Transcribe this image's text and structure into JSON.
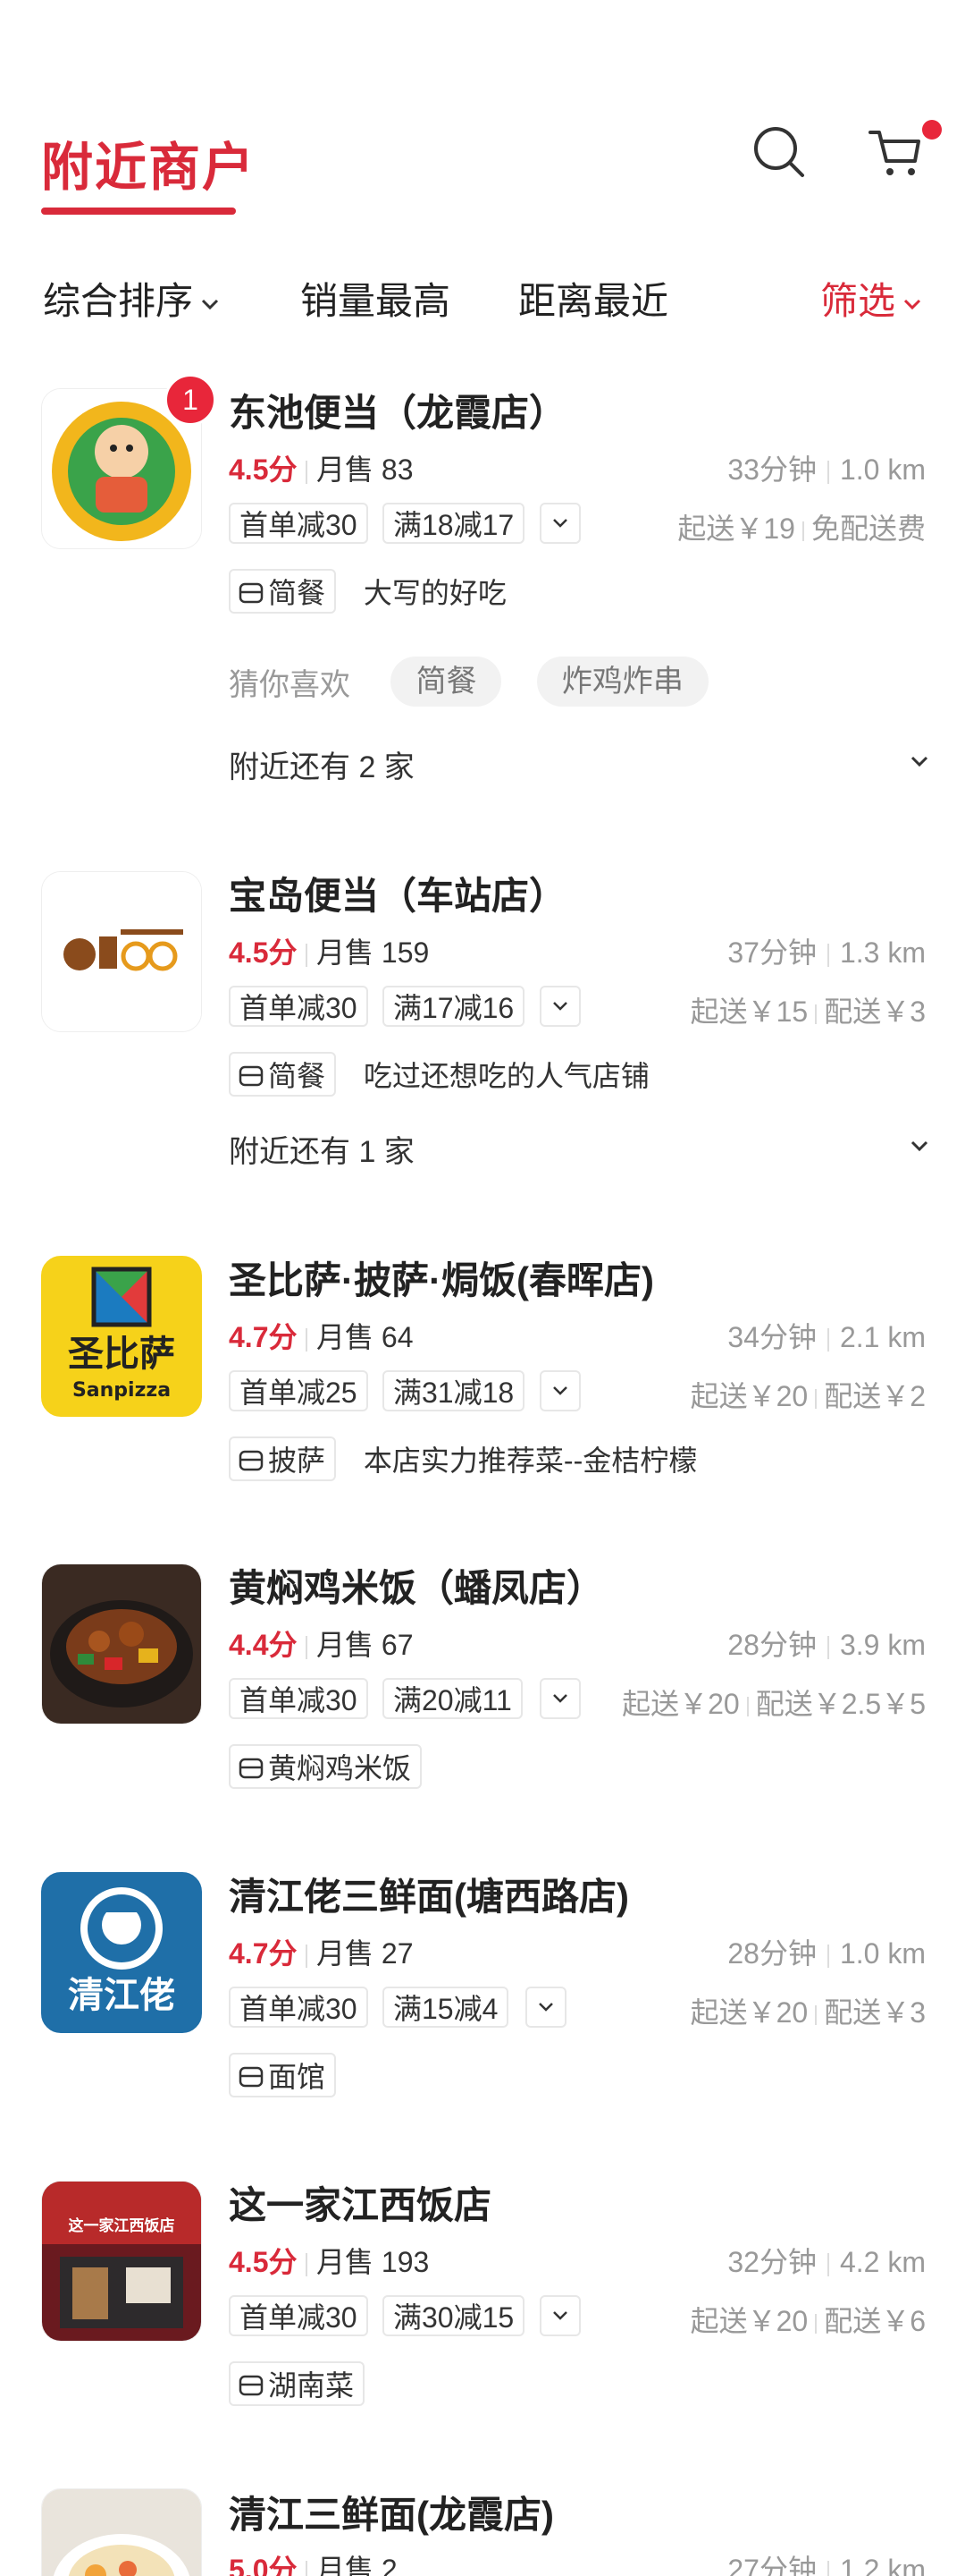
{
  "header": {
    "title": "附近商户"
  },
  "icons": {
    "search": "search-icon",
    "cart": "cart-icon"
  },
  "filters": {
    "sort": "综合排序",
    "sales": "销量最高",
    "distance": "距离最近",
    "filter": "筛选"
  },
  "colors": {
    "accent": "#d92a3a",
    "muted": "#999999"
  },
  "shops": [
    {
      "name": "东池便当（龙霞店）",
      "badge": "1",
      "score": "4.5分",
      "sales": "月售 83",
      "time": "33分钟",
      "distance": "1.0 km",
      "promos": [
        "首单减30",
        "满18减17"
      ],
      "min_order": "起送￥19",
      "fee": "免配送费",
      "category": "简餐",
      "desc": "大写的好吃",
      "guess_label": "猜你喜欢",
      "guess": [
        "简餐",
        "炸鸡炸串"
      ],
      "nearby": "附近还有 2 家"
    },
    {
      "name": "宝岛便当（车站店）",
      "score": "4.5分",
      "sales": "月售 159",
      "time": "37分钟",
      "distance": "1.3 km",
      "promos": [
        "首单减30",
        "满17减16"
      ],
      "min_order": "起送￥15",
      "fee": "配送￥3",
      "category": "简餐",
      "desc": "吃过还想吃的人气店铺",
      "nearby": "附近还有 1 家"
    },
    {
      "name": "圣比萨·披萨·焗饭(春晖店)",
      "score": "4.7分",
      "sales": "月售 64",
      "time": "34分钟",
      "distance": "2.1 km",
      "promos": [
        "首单减25",
        "满31减18"
      ],
      "min_order": "起送￥20",
      "fee": "配送￥2",
      "category": "披萨",
      "desc": "本店实力推荐菜--金桔柠檬",
      "logo_text": "圣比萨",
      "logo_sub": "Sanpizza"
    },
    {
      "name": "黄焖鸡米饭（蟠凤店）",
      "score": "4.4分",
      "sales": "月售 67",
      "time": "28分钟",
      "distance": "3.9 km",
      "promos": [
        "首单减30",
        "满20减11"
      ],
      "min_order": "起送￥20",
      "fee": "配送￥2.5￥5",
      "category": "黄焖鸡米饭"
    },
    {
      "name": "清江佬三鲜面(塘西路店)",
      "score": "4.7分",
      "sales": "月售 27",
      "time": "28分钟",
      "distance": "1.0 km",
      "promos": [
        "首单减30",
        "满15减4"
      ],
      "min_order": "起送￥20",
      "fee": "配送￥3",
      "category": "面馆",
      "logo_text": "清江佬"
    },
    {
      "name": "这一家江西饭店",
      "score": "4.5分",
      "sales": "月售 193",
      "time": "32分钟",
      "distance": "4.2 km",
      "promos": [
        "首单减30",
        "满30减15"
      ],
      "min_order": "起送￥20",
      "fee": "配送￥6",
      "category": "湖南菜",
      "logo_text": "这一家江西饭店"
    },
    {
      "name": "清江三鲜面(龙霞店)",
      "score": "5.0分",
      "sales": "月售 2",
      "time": "27分钟",
      "distance": "1.2 km"
    }
  ]
}
